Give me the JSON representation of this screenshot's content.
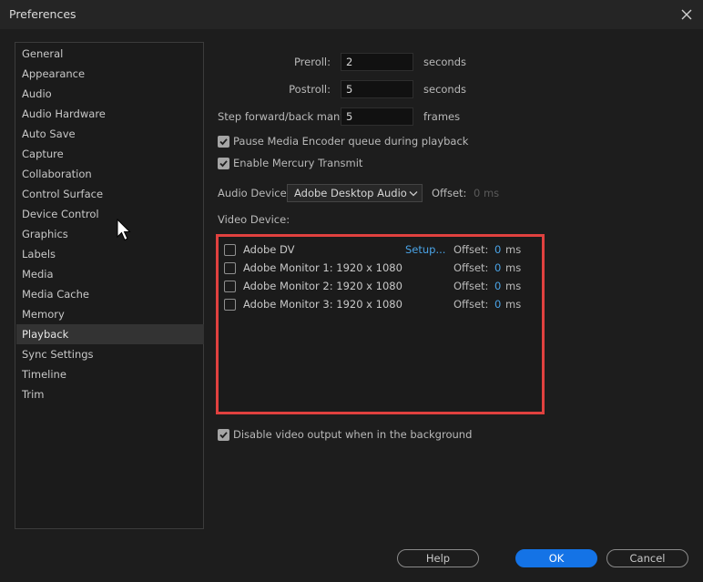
{
  "window": {
    "title": "Preferences"
  },
  "sidebar": {
    "items": [
      {
        "label": "General"
      },
      {
        "label": "Appearance"
      },
      {
        "label": "Audio"
      },
      {
        "label": "Audio Hardware"
      },
      {
        "label": "Auto Save"
      },
      {
        "label": "Capture"
      },
      {
        "label": "Collaboration"
      },
      {
        "label": "Control Surface"
      },
      {
        "label": "Device Control"
      },
      {
        "label": "Graphics"
      },
      {
        "label": "Labels"
      },
      {
        "label": "Media"
      },
      {
        "label": "Media Cache"
      },
      {
        "label": "Memory"
      },
      {
        "label": "Playback"
      },
      {
        "label": "Sync Settings"
      },
      {
        "label": "Timeline"
      },
      {
        "label": "Trim"
      }
    ],
    "selected": "Playback"
  },
  "playback": {
    "preroll": {
      "label": "Preroll:",
      "value": "2",
      "unit": "seconds"
    },
    "postroll": {
      "label": "Postroll:",
      "value": "5",
      "unit": "seconds"
    },
    "step": {
      "label": "Step forward/back many:",
      "value": "5",
      "unit": "frames"
    },
    "pause_encoder": {
      "label": "Pause Media Encoder queue during playback",
      "checked": true
    },
    "mercury": {
      "label": "Enable Mercury Transmit",
      "checked": true
    },
    "audio_device": {
      "label": "Audio Device:",
      "value": "Adobe Desktop Audio",
      "offset_label": "Offset:",
      "offset_value": "0 ms"
    },
    "video_device": {
      "label": "Video Device:",
      "devices": [
        {
          "name": "Adobe DV",
          "setup": "Setup...",
          "offset_label": "Offset:",
          "offset_value": "0",
          "unit": "ms",
          "checked": false
        },
        {
          "name": "Adobe Monitor 1: 1920 x 1080",
          "offset_label": "Offset:",
          "offset_value": "0",
          "unit": "ms",
          "checked": false
        },
        {
          "name": "Adobe Monitor 2: 1920 x 1080",
          "offset_label": "Offset:",
          "offset_value": "0",
          "unit": "ms",
          "checked": false
        },
        {
          "name": "Adobe Monitor 3: 1920 x 1080",
          "offset_label": "Offset:",
          "offset_value": "0",
          "unit": "ms",
          "checked": false
        }
      ]
    },
    "disable_bg": {
      "label": "Disable video output when in the background",
      "checked": true
    }
  },
  "buttons": {
    "help": "Help",
    "ok": "OK",
    "cancel": "Cancel"
  },
  "colors": {
    "accent": "#1473e6",
    "highlight_box": "#e0413f",
    "link": "#4aa3e6"
  }
}
